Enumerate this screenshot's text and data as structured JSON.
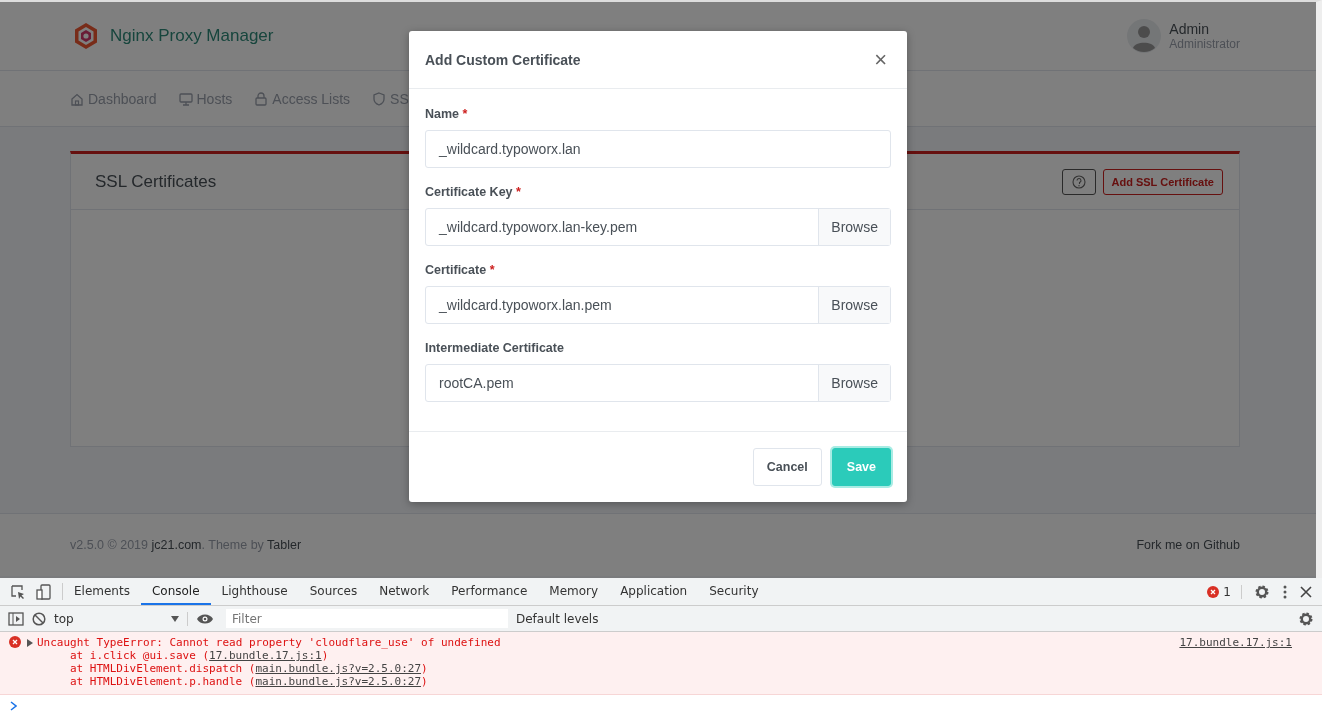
{
  "header": {
    "brand": "Nginx Proxy Manager",
    "user": {
      "name": "Admin",
      "role": "Administrator"
    }
  },
  "nav": [
    {
      "label": "Dashboard"
    },
    {
      "label": "Hosts"
    },
    {
      "label": "Access Lists"
    },
    {
      "label": "SS"
    }
  ],
  "card": {
    "title": "SSL Certificates",
    "add_button": "Add SSL Certificate"
  },
  "footer": {
    "prefix": "v2.5.0 © 2019",
    "site_link": "jc21.com",
    "middle": ". Theme by",
    "theme_link": "Tabler",
    "github_link": "Fork me on Github"
  },
  "modal": {
    "title": "Add Custom Certificate",
    "close": "×",
    "required_mark": "*",
    "fields": [
      {
        "kind": "text",
        "label": "Name",
        "required": true,
        "value": "_wildcard.typoworx.lan"
      },
      {
        "kind": "file",
        "label": "Certificate Key",
        "required": true,
        "value": "_wildcard.typoworx.lan-key.pem",
        "browse": "Browse"
      },
      {
        "kind": "file",
        "label": "Certificate",
        "required": true,
        "value": "_wildcard.typoworx.lan.pem",
        "browse": "Browse"
      },
      {
        "kind": "file",
        "label": "Intermediate Certificate",
        "required": false,
        "value": "rootCA.pem",
        "browse": "Browse"
      }
    ],
    "cancel": "Cancel",
    "save": "Save"
  },
  "devtools": {
    "tabs": [
      {
        "label": "Elements",
        "selected": false
      },
      {
        "label": "Console",
        "selected": true
      },
      {
        "label": "Lighthouse",
        "selected": false
      },
      {
        "label": "Sources",
        "selected": false
      },
      {
        "label": "Network",
        "selected": false
      },
      {
        "label": "Performance",
        "selected": false
      },
      {
        "label": "Memory",
        "selected": false
      },
      {
        "label": "Application",
        "selected": false
      },
      {
        "label": "Security",
        "selected": false
      }
    ],
    "error_count": "1",
    "context": "top",
    "filter_placeholder": "Filter",
    "levels": "Default levels",
    "error": {
      "message": "Uncaught TypeError: Cannot read property 'cloudflare_use' of undefined",
      "source": "17.bundle.17.js:1",
      "stack": [
        {
          "text": "at i.click @ui.save (",
          "link": "17.bundle.17.js:1",
          "suffix": ")"
        },
        {
          "text": "at HTMLDivElement.dispatch (",
          "link": "main.bundle.js?v=2.5.0:27",
          "suffix": ")"
        },
        {
          "text": "at HTMLDivElement.p.handle (",
          "link": "main.bundle.js?v=2.5.0:27",
          "suffix": ")"
        }
      ]
    }
  }
}
